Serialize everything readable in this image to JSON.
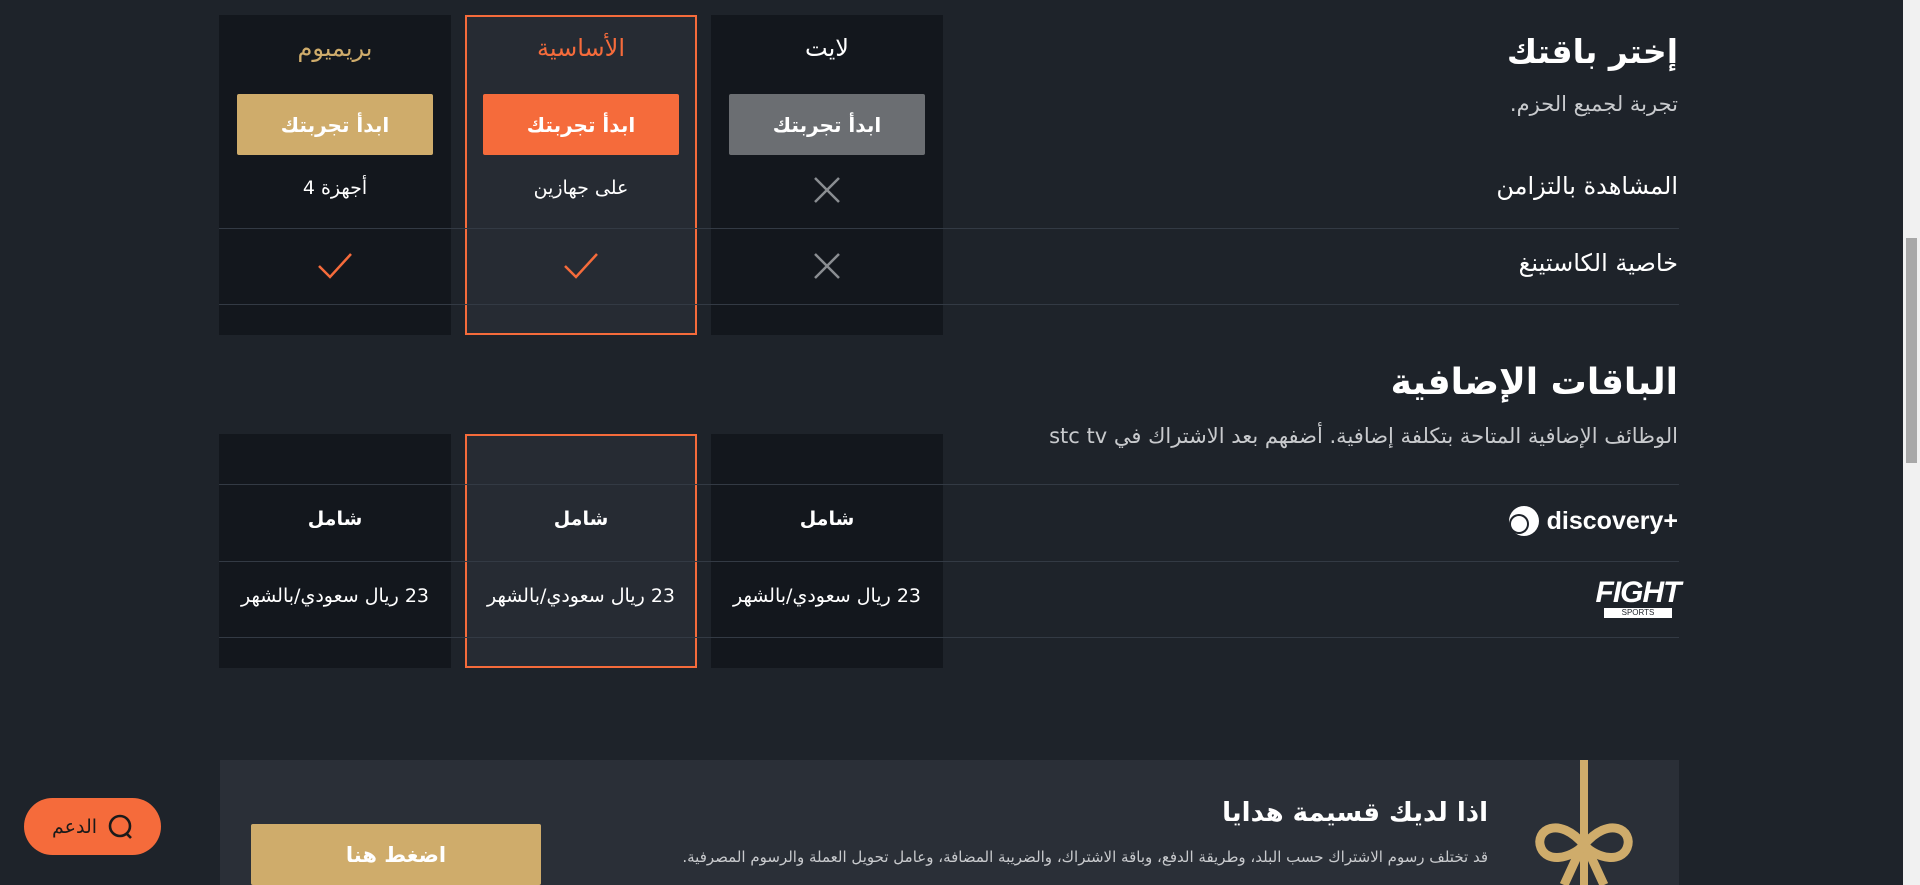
{
  "plans": {
    "lite": {
      "name": "لايت",
      "button": "ابدأ تجربتك",
      "concurrent": "",
      "casting": ""
    },
    "basic": {
      "name": "الأساسية",
      "button": "ابدأ تجربتك",
      "concurrent": "على جهازين",
      "casting": ""
    },
    "premium": {
      "name": "بريميوم",
      "button": "ابدأ تجربتك",
      "concurrent": "4 أجهزة",
      "casting": ""
    }
  },
  "choose": {
    "title": "إختر باقتك",
    "subtitle": "تجربة لجميع الحزم.",
    "row_concurrent": "المشاهدة بالتزامن",
    "row_casting": "خاصية الكاستينغ"
  },
  "addons": {
    "title": "الباقات الإضافية",
    "subtitle": "الوظائف الإضافية المتاحة بتكلفة إضافية. أضفهم بعد الاشتراك في stc tv",
    "discovery": {
      "logo_text": "discovery+",
      "lite": "شامل",
      "basic": "شامل",
      "premium": "شامل"
    },
    "fight": {
      "logo_text": "FIGHT",
      "logo_sub": "SPORTS",
      "lite": "23 ريال سعودي/بالشهر",
      "basic": "23 ريال سعودي/بالشهر",
      "premium": "23 ريال سعودي/بالشهر"
    }
  },
  "gift": {
    "title": "اذا لديك قسيمة هدايا",
    "text": "قد تختلف رسوم الاشتراك حسب البلد، وطريقة الدفع، وباقة الاشتراك، والضريبة المضافة، وعامل تحويل العملة والرسوم المصرفية.",
    "button": "اضغط هنا"
  },
  "support": {
    "label": "الدعم",
    "icon": "chat-icon"
  },
  "colors": {
    "accent": "#f56b3b",
    "gold": "#cfac6b",
    "gray_button": "#6b6e72",
    "dark": "#13171d"
  }
}
